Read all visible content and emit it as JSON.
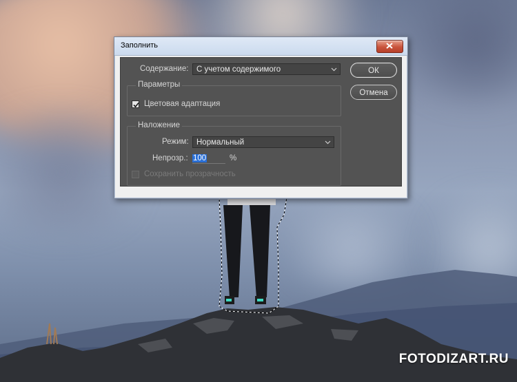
{
  "dialog": {
    "title": "Заполнить",
    "contents_label": "Содержание:",
    "contents_value": "С учетом содержимого",
    "ok_label": "ОК",
    "cancel_label": "Отмена",
    "options_group": "Параметры",
    "color_adaptation_label": "Цветовая адаптация",
    "color_adaptation_checked": true,
    "blending_group": "Наложение",
    "mode_label": "Режим:",
    "mode_value": "Нормальный",
    "opacity_label": "Непрозр.:",
    "opacity_value": "100",
    "opacity_unit": "%",
    "preserve_transparency_label": "Сохранить прозрачность",
    "preserve_transparency_checked": false
  },
  "watermark": "FOTODIZART.RU",
  "colors": {
    "dialog_body": "#535353",
    "selection_highlight": "#2a6fd6",
    "close_button": "#c9543c"
  },
  "icons": [
    "close-icon",
    "chevron-down-icon",
    "checkmark-icon"
  ]
}
